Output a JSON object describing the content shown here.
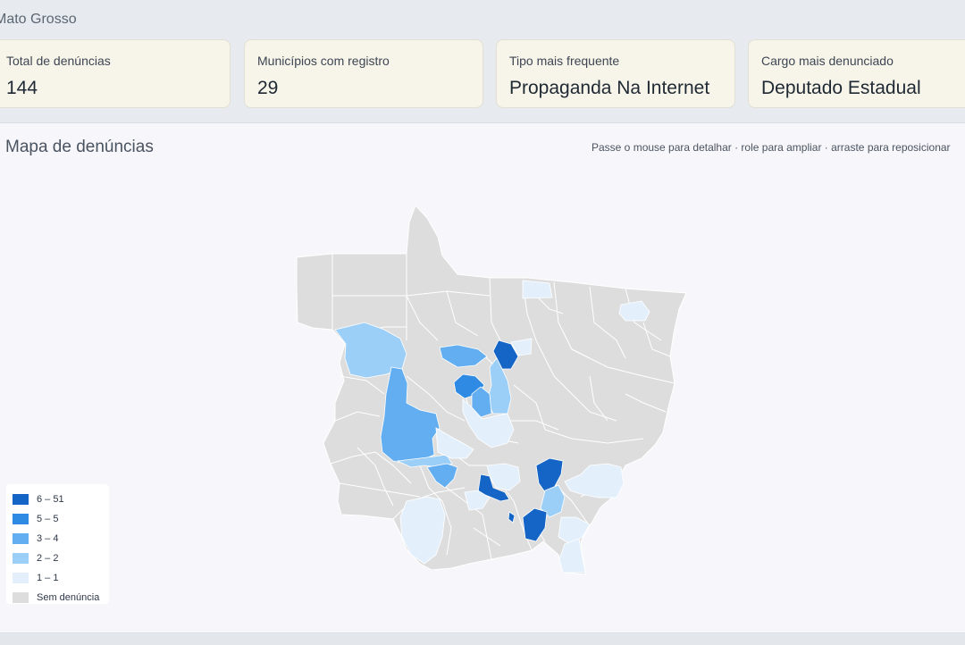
{
  "page": {
    "title": "Mato Grosso"
  },
  "kpis": [
    {
      "label": "Total de denúncias",
      "value": "144"
    },
    {
      "label": "Municípios com registro",
      "value": "29"
    },
    {
      "label": "Tipo mais frequente",
      "value": "Propaganda Na Internet"
    },
    {
      "label": "Cargo mais denunciado",
      "value": "Deputado Estadual"
    }
  ],
  "map": {
    "title": "Mapa de denúncias",
    "hint": "Passe o mouse para detalhar · role para ampliar · arraste para reposicionar",
    "colors": {
      "none": "#dddddd",
      "border": "#ffffff",
      "c1": "#e3f0fc",
      "c2": "#9ccff7",
      "c3": "#63aef0",
      "c4": "#2f8ae4",
      "c5": "#1565c6"
    },
    "legend": [
      {
        "label": "6 – 51",
        "color": "#1565c6"
      },
      {
        "label": "5 – 5",
        "color": "#2f8ae4"
      },
      {
        "label": "3 – 4",
        "color": "#63aef0"
      },
      {
        "label": "2 – 2",
        "color": "#9ccff7"
      },
      {
        "label": "1 – 1",
        "color": "#e3f0fc"
      },
      {
        "label": "Sem denúncia",
        "color": "#dddddd"
      }
    ]
  }
}
